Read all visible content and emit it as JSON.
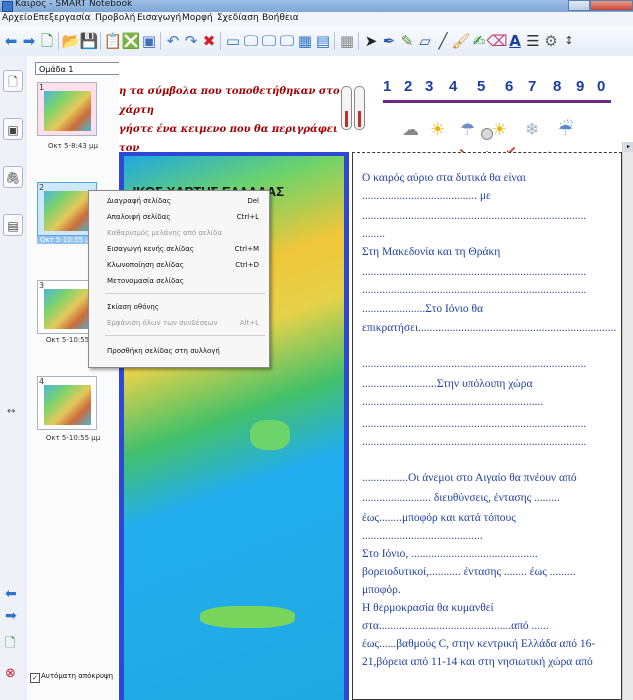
{
  "window": {
    "title": "Καιρος - SMART Notebook"
  },
  "menu": [
    "Αρχείο",
    "Επεξεργασία",
    "Προβολή",
    "Εισαγωγή",
    "Μορφή",
    "Σχεδίαση",
    "Βοήθεια"
  ],
  "toolbar": {
    "icons": [
      "back-icon",
      "forward-icon",
      "add-page-icon",
      "open-icon",
      "save-icon",
      "paste-icon",
      "delete-page-icon",
      "undo-icon",
      "redo-icon",
      "delete-icon",
      "screen-shade-icon",
      "full-screen-icon",
      "dual-display-icon",
      "screen-capture-icon",
      "document-camera-icon",
      "table-icon",
      "select-icon",
      "pen-icon",
      "creative-pen-icon",
      "shape-icon",
      "line-icon",
      "fill-icon",
      "magic-pen-icon",
      "eraser-icon",
      "text-icon",
      "properties-icon",
      "add-ons-icon",
      "move-toolbar-icon"
    ]
  },
  "sorter": {
    "group": "Ομάδα 1",
    "pages": [
      {
        "num": "1",
        "caption": "Οκτ 5-8:43 μμ"
      },
      {
        "num": "2",
        "caption": "Οκτ 5-10:55 μμ"
      },
      {
        "num": "3",
        "caption": "Οκτ 5-10:55 μμ"
      },
      {
        "num": "4",
        "caption": "Οκτ 5-10:55 μμ"
      }
    ],
    "autohide": "Αυτόματη απόκρυψη"
  },
  "context_menu": {
    "items": [
      {
        "label": "Διαγραφή σελίδας",
        "shortcut": "Del",
        "enabled": true
      },
      {
        "label": "Απαλοιφή σελίδας",
        "shortcut": "Ctrl+L",
        "enabled": true
      },
      {
        "label": "Καθαρισμός μελάνης από σελίδα",
        "shortcut": "",
        "enabled": false
      },
      {
        "label": "Εισαγωγή κενής σελίδας",
        "shortcut": "Ctrl+M",
        "enabled": true
      },
      {
        "label": "Κλωνοποίηση σελίδας",
        "shortcut": "Ctrl+D",
        "enabled": true
      },
      {
        "label": "Μετονομασία σελίδας",
        "shortcut": "",
        "enabled": true
      },
      {
        "label": "Σκίαση οθόνης",
        "shortcut": "",
        "enabled": true
      },
      {
        "label": "Εμφάνιση όλων των συνδέσεων",
        "shortcut": "Alt+L",
        "enabled": false
      },
      {
        "label": "Προσθήκη σελίδας στη συλλογή",
        "shortcut": "",
        "enabled": true
      }
    ]
  },
  "page": {
    "heading_line1": "η τα σύμβολα που τοποθετήθηκαν στο χάρτη",
    "heading_line2": "γήστε ένα κειμενο που θα περιγράφει τον",
    "numbers": [
      "1",
      "2",
      "3",
      "4",
      "5",
      "6",
      "7",
      "8",
      "9",
      "0"
    ],
    "weather_icons": [
      "cloud-icon",
      "sun-icon",
      "rain-cloud-icon",
      "sun-cloud-icon",
      "snow-icon",
      "rain-icon"
    ],
    "map_title": "ΙΚΟΣ ΧΑΡΤΗΣ ΕΛΛΑΔΑΣ",
    "text_lines": [
      "Ο καιρός αύριο στα δυτικά θα είναι",
      "........................................ με",
      "..............................................................................",
      "........",
      "Στη Μακεδονία και τη Θράκη",
      "..............................................................................",
      "..............................................................................",
      "......................Στο Ιόνιο θα",
      "επικρατήσει.....................................................................",
      "..............................................................................",
      "..........................Στην υπόλοιπη  χώρα",
      "...............................................................",
      "..............................................................................",
      "..............................................................................",
      "................Οι άνεμοι στο Αιγαίο θα πνέουν από",
      "........................ διευθύνσεις, έντασης .........",
      "έως........μποφόρ και κατά τόπους",
      "..........................................",
      "Στο Ιόνιο, ............................................",
      "βορειοδυτικοί,........... έντασης ........ έως .........",
      "μποφόρ.",
      "Η θερμοκρασία θα κυμανθεί",
      "στα..............................................από ......",
      "έως......βαθμούς C, στην κεντρική Ελλάδα από 16-",
      "21,βόρεια από 11-14 και στη νησιωτική χώρα από"
    ]
  },
  "colors": {
    "accent_blue": "#1a3fa0",
    "heading_red": "#a00000",
    "map_border": "#2f47d6",
    "text_blue": "#1f3fa5"
  }
}
